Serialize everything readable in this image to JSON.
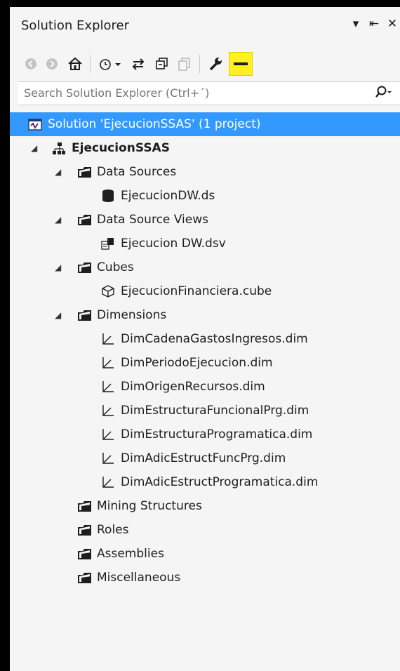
{
  "panel": {
    "title": "Solution Explorer",
    "controls": {
      "dropdown": "▾",
      "pin": "⇤",
      "close": "✕"
    }
  },
  "toolbar": {
    "icons": [
      "back-icon",
      "forward-icon",
      "home-icon",
      "history-icon",
      "sync-icon",
      "collapse-icon",
      "copy-icon",
      "settings-icon",
      "pin-icon"
    ]
  },
  "search": {
    "placeholder": "Search Solution Explorer (Ctrl+´)"
  },
  "tree": {
    "solution": "Solution 'EjecucionSSAS' (1 project)",
    "project": "EjecucionSSAS",
    "folders": {
      "data_sources": "Data Sources",
      "data_source_views": "Data Source Views",
      "cubes": "Cubes",
      "dimensions": "Dimensions",
      "mining_structures": "Mining Structures",
      "roles": "Roles",
      "assemblies": "Assemblies",
      "miscellaneous": "Miscellaneous"
    },
    "items": {
      "ds": "EjecucionDW.ds",
      "dsv": "Ejecucion DW.dsv",
      "cube": "EjecucionFinanciera.cube",
      "dims": [
        "DimCadenaGastosIngresos.dim",
        "DimPeriodoEjecucion.dim",
        "DimOrigenRecursos.dim",
        "DimEstructuraFuncionalPrg.dim",
        "DimEstructuraProgramatica.dim",
        "DimAdicEstructFuncPrg.dim",
        "DimAdicEstructProgramatica.dim"
      ]
    }
  }
}
